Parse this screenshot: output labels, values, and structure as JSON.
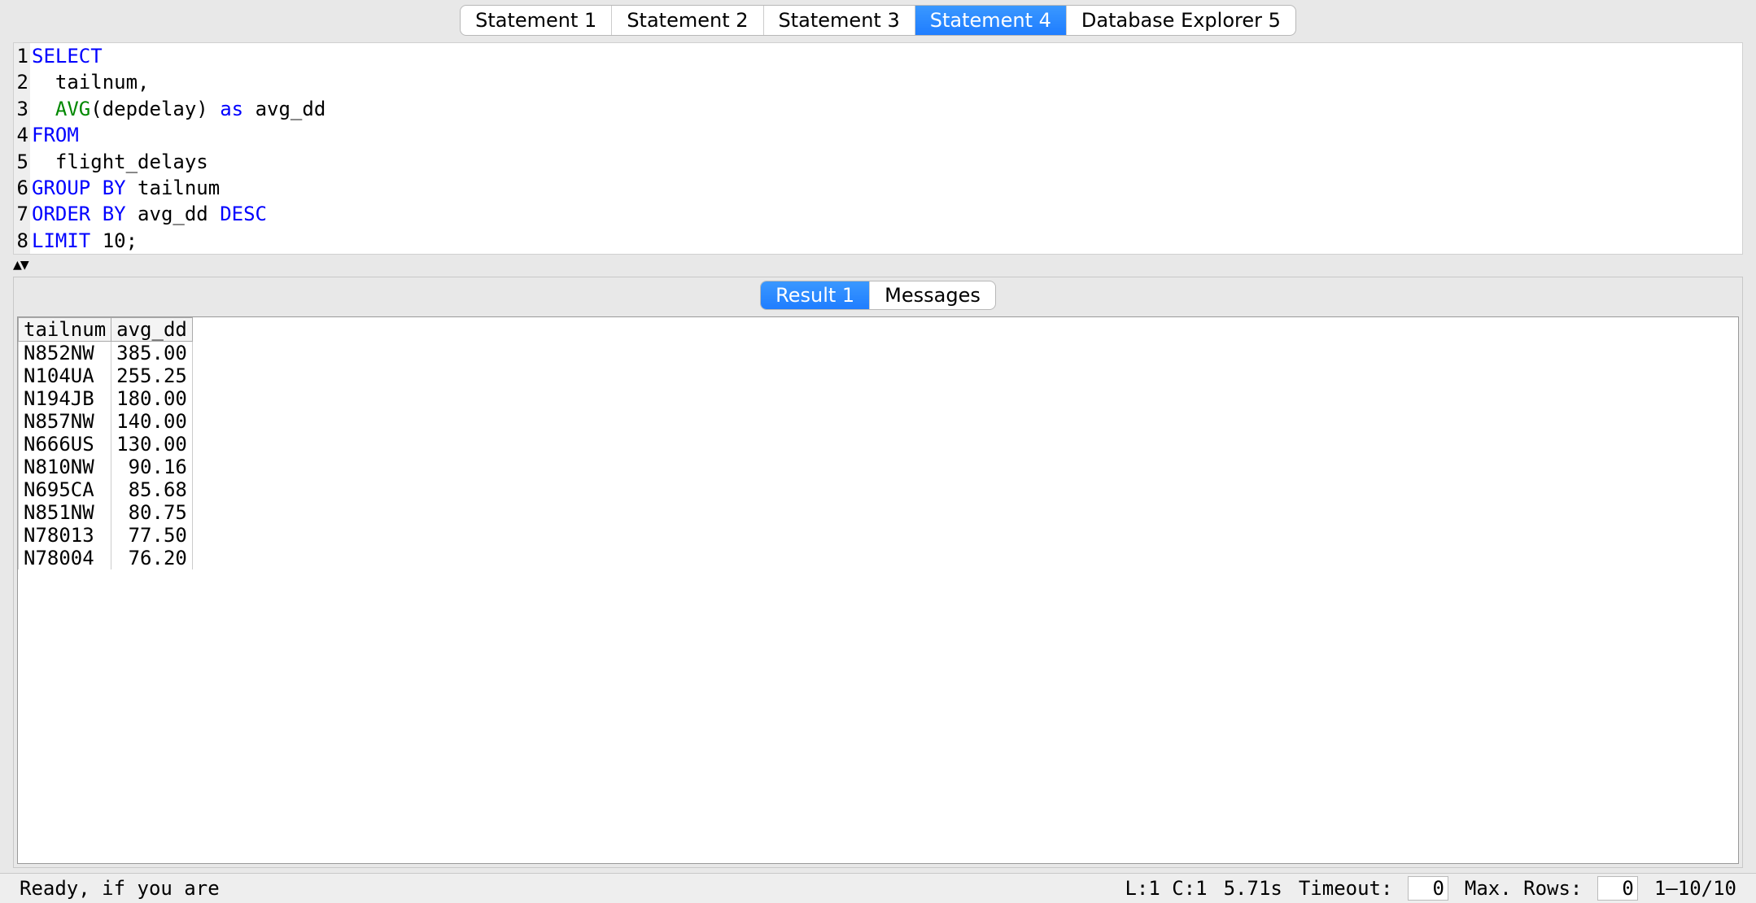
{
  "tabs": [
    {
      "label": "Statement 1",
      "active": false
    },
    {
      "label": "Statement 2",
      "active": false
    },
    {
      "label": "Statement 3",
      "active": false
    },
    {
      "label": "Statement 4",
      "active": true
    },
    {
      "label": "Database Explorer 5",
      "active": false
    }
  ],
  "editor": {
    "lines": [
      [
        {
          "t": "SELECT",
          "c": "kw"
        }
      ],
      [
        {
          "t": "  tailnum,",
          "c": "plain"
        }
      ],
      [
        {
          "t": "  ",
          "c": "plain"
        },
        {
          "t": "AVG",
          "c": "func"
        },
        {
          "t": "(depdelay) ",
          "c": "plain"
        },
        {
          "t": "as",
          "c": "kw"
        },
        {
          "t": " avg_dd",
          "c": "plain"
        }
      ],
      [
        {
          "t": "FROM",
          "c": "kw"
        }
      ],
      [
        {
          "t": "  flight_delays",
          "c": "plain"
        }
      ],
      [
        {
          "t": "GROUP BY",
          "c": "kw"
        },
        {
          "t": " tailnum",
          "c": "plain"
        }
      ],
      [
        {
          "t": "ORDER BY",
          "c": "kw"
        },
        {
          "t": " avg_dd ",
          "c": "plain"
        },
        {
          "t": "DESC",
          "c": "kw"
        }
      ],
      [
        {
          "t": "LIMIT",
          "c": "kw"
        },
        {
          "t": " 10;",
          "c": "plain"
        }
      ]
    ]
  },
  "splitter_glyph": "▲▼",
  "result_tabs": [
    {
      "label": "Result 1",
      "active": true
    },
    {
      "label": "Messages",
      "active": false
    }
  ],
  "result_table": {
    "columns": [
      "tailnum",
      "avg_dd"
    ],
    "rows": [
      [
        "N852NW",
        "385.00"
      ],
      [
        "N104UA",
        "255.25"
      ],
      [
        "N194JB",
        "180.00"
      ],
      [
        "N857NW",
        "140.00"
      ],
      [
        "N666US",
        "130.00"
      ],
      [
        "N810NW",
        "90.16"
      ],
      [
        "N695CA",
        "85.68"
      ],
      [
        "N851NW",
        "80.75"
      ],
      [
        "N78013",
        "77.50"
      ],
      [
        "N78004",
        "76.20"
      ]
    ]
  },
  "status": {
    "ready": "Ready, if you are",
    "cursor": "L:1 C:1",
    "elapsed": "5.71s",
    "timeout_label": "Timeout:",
    "timeout_value": "0",
    "maxrows_label": "Max. Rows:",
    "maxrows_value": "0",
    "range": "1–10/10"
  }
}
